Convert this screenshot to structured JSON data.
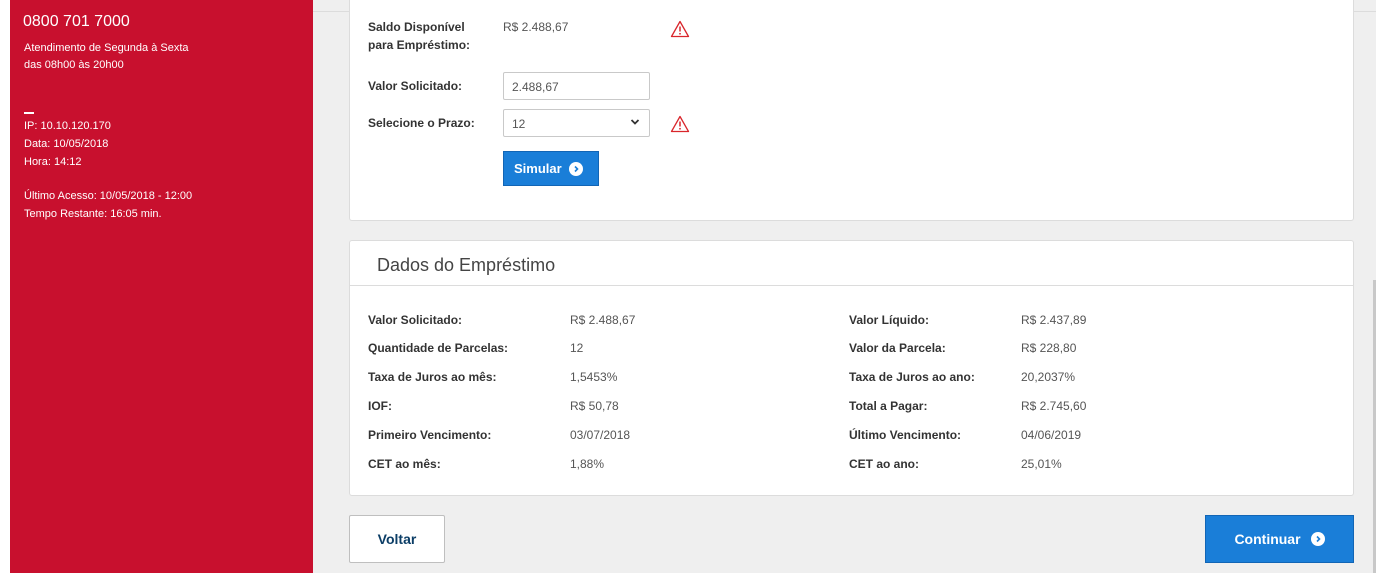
{
  "sidebar": {
    "phone": "0800 701 7000",
    "hours_line1": "Atendimento de Segunda à Sexta",
    "hours_line2": "das 08h00 às 20h00",
    "ip": "IP: 10.10.120.170",
    "date": "Data: 10/05/2018",
    "time": "Hora: 14:12",
    "last_access": "Último Acesso: 10/05/2018 - 12:00",
    "time_left": "Tempo Restante: 16:05 min."
  },
  "simulation": {
    "saldo_label_line1": "Saldo Disponível",
    "saldo_label_line2": "para Empréstimo:",
    "saldo_value": "R$ 2.488,67",
    "valor_label": "Valor Solicitado:",
    "valor_input": "2.488,67",
    "prazo_label": "Selecione o Prazo:",
    "prazo_selected": "12",
    "simular_label": "Simular"
  },
  "loan": {
    "title": "Dados do Empréstimo",
    "left": [
      {
        "label": "Valor Solicitado:",
        "value": "R$ 2.488,67"
      },
      {
        "label": "Quantidade de Parcelas:",
        "value": "12"
      },
      {
        "label": "Taxa de Juros ao mês:",
        "value": "1,5453%"
      },
      {
        "label": "IOF:",
        "value": "R$ 50,78"
      },
      {
        "label": "Primeiro Vencimento:",
        "value": "03/07/2018"
      },
      {
        "label": "CET ao mês:",
        "value": "1,88%"
      }
    ],
    "right": [
      {
        "label": "Valor Líquido:",
        "value": "R$ 2.437,89"
      },
      {
        "label": "Valor da Parcela:",
        "value": "R$ 228,80"
      },
      {
        "label": "Taxa de Juros ao ano:",
        "value": "20,2037%"
      },
      {
        "label": "Total a Pagar:",
        "value": "R$ 2.745,60"
      },
      {
        "label": "Último Vencimento:",
        "value": "04/06/2019"
      },
      {
        "label": "CET ao ano:",
        "value": "25,01%"
      }
    ]
  },
  "actions": {
    "voltar": "Voltar",
    "continuar": "Continuar"
  },
  "colors": {
    "sidebar": "#c8102e",
    "primary": "#1a7ed8",
    "warning": "#d9262c"
  },
  "icons": [
    "warning-icon",
    "chevron-down-icon",
    "arrow-right-circle-icon"
  ]
}
